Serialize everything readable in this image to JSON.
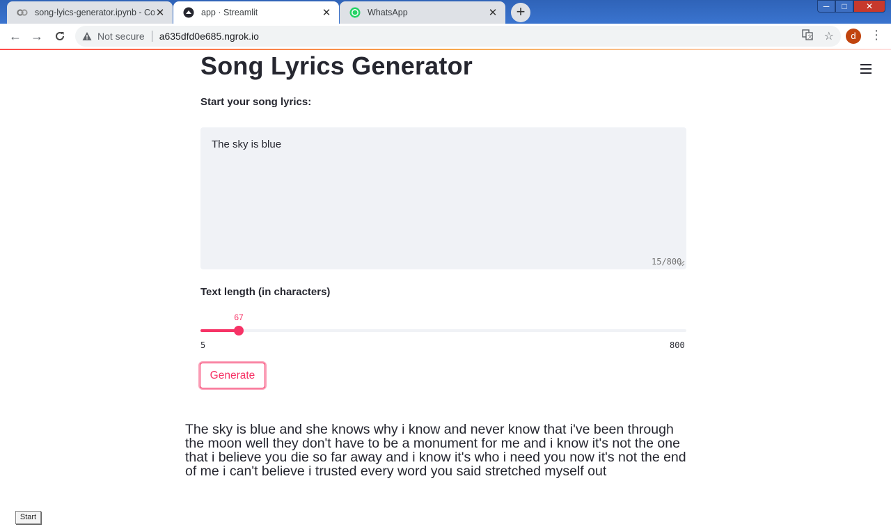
{
  "browser": {
    "tabs": [
      {
        "title": "song-lyics-generator.ipynb - Cola",
        "icon": "colab-icon"
      },
      {
        "title": "app · Streamlit",
        "icon": "streamlit-icon"
      },
      {
        "title": "WhatsApp",
        "icon": "whatsapp-icon"
      }
    ],
    "security_label": "Not secure",
    "url": "a635dfd0e685.ngrok.io",
    "profile_initial": "d",
    "window_controls": {
      "minimize": "─",
      "maximize": "□",
      "close": "✕"
    }
  },
  "app": {
    "title": "Song Lyrics Generator",
    "prompt_label": "Start your song lyrics:",
    "prompt_value": "The sky is blue",
    "char_count": "15/800",
    "length_label": "Text length (in characters)",
    "slider": {
      "value": "67",
      "min": "5",
      "max": "800",
      "level": 0.0789
    },
    "generate_label": "Generate",
    "output_text": "The sky is blue and she knows why i know and never know that i've been through the moon well they don't have to be a monument for me and i know it's not the one that i believe you die so far away and i know it's who i need you now it's not the end of me i can't believe i trusted every word you said stretched myself out"
  },
  "taskbar": {
    "start_label": "Start"
  },
  "colors": {
    "accent": "#f63366",
    "text": "#262730",
    "input_bg": "#f0f2f6"
  }
}
